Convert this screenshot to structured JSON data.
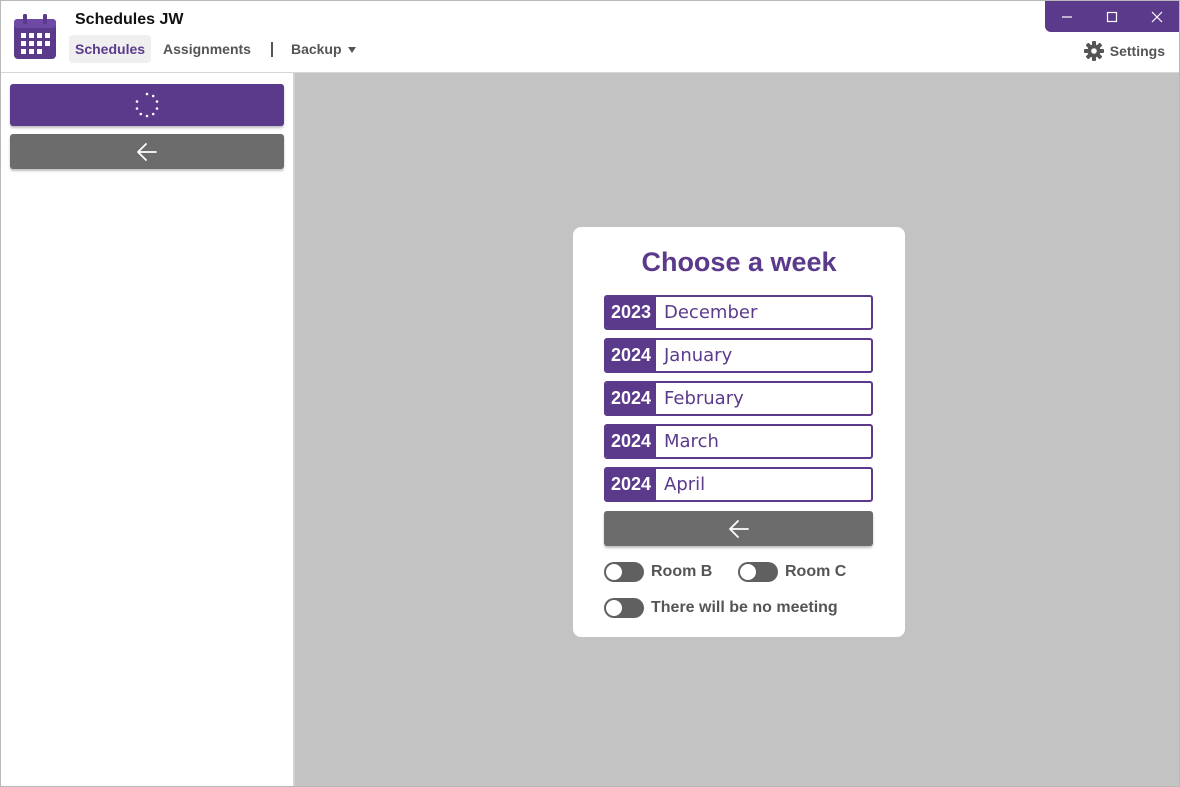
{
  "app": {
    "title": "Schedules JW",
    "logo_icon": "calendar-icon"
  },
  "nav": {
    "items": [
      {
        "label": "Schedules",
        "active": true
      },
      {
        "label": "Assignments",
        "active": false
      },
      {
        "label": "Backup",
        "active": false
      }
    ]
  },
  "window_controls": {
    "minimize_icon": "minimize-icon",
    "maximize_icon": "maximize-icon",
    "close_icon": "close-icon"
  },
  "settings": {
    "label": "Settings",
    "icon": "gear-icon"
  },
  "sidebar": {
    "load_icon": "spinner-icon",
    "back_icon": "arrow-left-icon"
  },
  "week_picker": {
    "title": "Choose a week",
    "months": [
      {
        "year": "2023",
        "month": "December"
      },
      {
        "year": "2024",
        "month": "January"
      },
      {
        "year": "2024",
        "month": "February"
      },
      {
        "year": "2024",
        "month": "March"
      },
      {
        "year": "2024",
        "month": "April"
      }
    ],
    "back_icon": "arrow-left-icon",
    "toggles": [
      {
        "label": "Room B",
        "on": false
      },
      {
        "label": "Room C",
        "on": false
      },
      {
        "label": "There will be no meeting",
        "on": false
      }
    ]
  },
  "colors": {
    "accent": "#5b3a8c",
    "neutral_button": "#6c6c6c",
    "main_background": "#c3c3c3"
  }
}
